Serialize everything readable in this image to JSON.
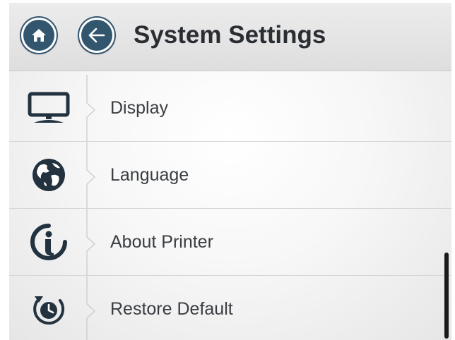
{
  "header": {
    "title": "System Settings",
    "home_icon": "home-icon",
    "back_icon": "back-arrow-icon"
  },
  "menu": {
    "items": [
      {
        "label": "Display",
        "icon": "monitor-icon"
      },
      {
        "label": "Language",
        "icon": "globe-icon"
      },
      {
        "label": "About Printer",
        "icon": "info-icon"
      },
      {
        "label": "Restore Default",
        "icon": "restore-clock-icon"
      }
    ]
  },
  "colors": {
    "accent": "#33566f",
    "icon": "#23323f",
    "text": "#3a3e42",
    "title": "#2a2e33"
  }
}
